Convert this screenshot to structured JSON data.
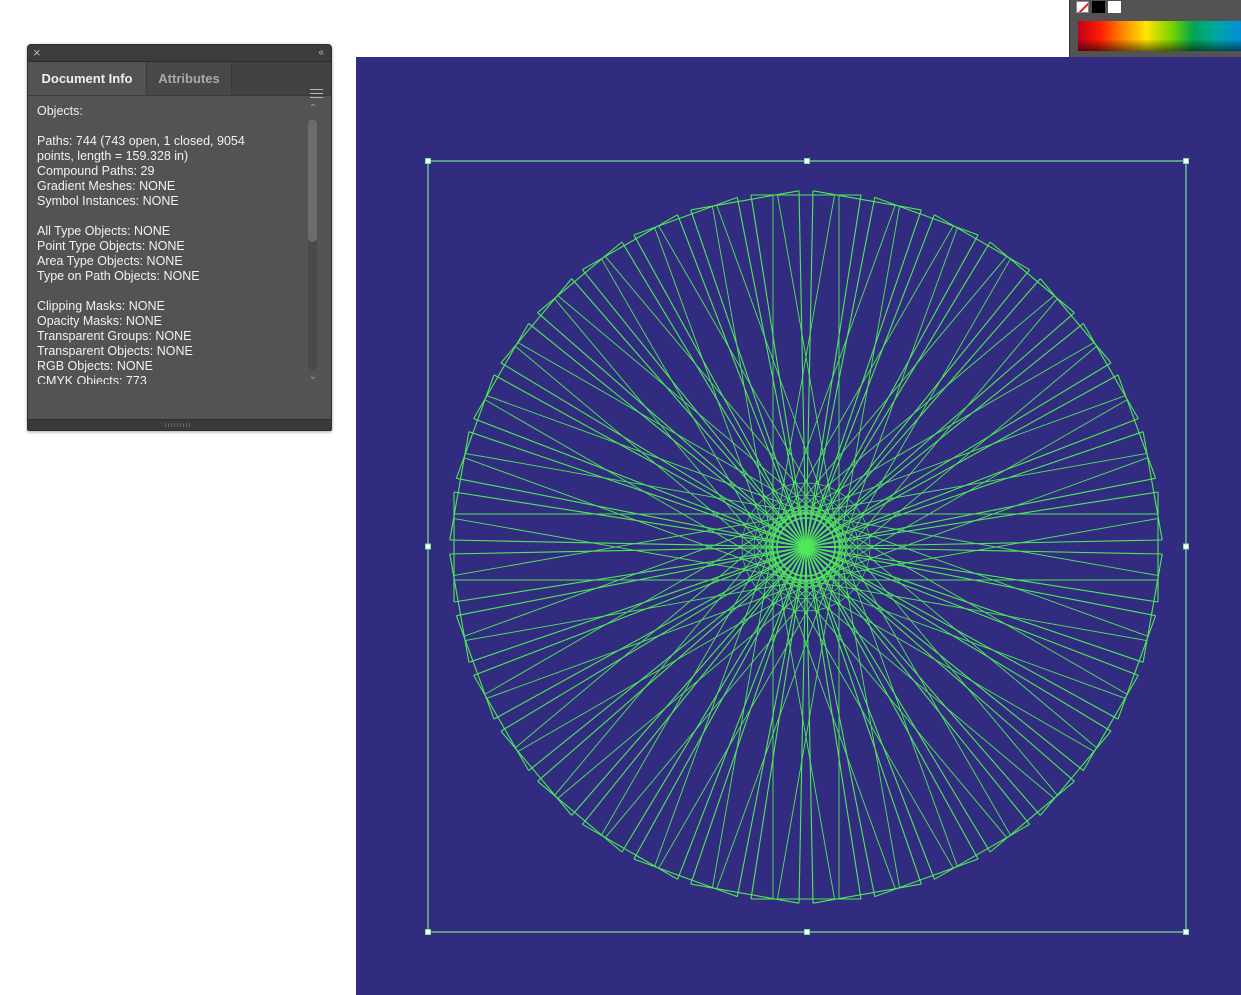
{
  "panel": {
    "close_glyph": "×",
    "collapse_glyph": "‹‹",
    "tabs": [
      {
        "label": "Document Info",
        "active": true
      },
      {
        "label": "Attributes",
        "active": false
      }
    ],
    "lines": [
      "Objects:",
      "",
      "Paths: 744 (743 open, 1 closed, 9054",
      "points, length = 159.328 in)",
      "Compound Paths: 29",
      "Gradient Meshes: NONE",
      "Symbol Instances: NONE",
      "",
      "All Type Objects: NONE",
      "Point Type Objects: NONE",
      "Area Type Objects: NONE",
      "Type on Path Objects: NONE",
      "",
      "Clipping Masks: NONE",
      "Opacity Masks: NONE",
      "Transparent Groups: NONE",
      "Transparent Objects: NONE",
      "RGB Objects: NONE",
      "CMYK Objects: 773"
    ],
    "scroll_up_glyph": "⌃",
    "scroll_down_glyph": "⌄"
  },
  "artboard": {
    "background_color": "#322c80",
    "selection_color": "#78e39a",
    "stroke_color": "#4fe85a"
  },
  "colors": {
    "panel_bg": "#535353",
    "panel_dark": "#3c3c3c"
  }
}
